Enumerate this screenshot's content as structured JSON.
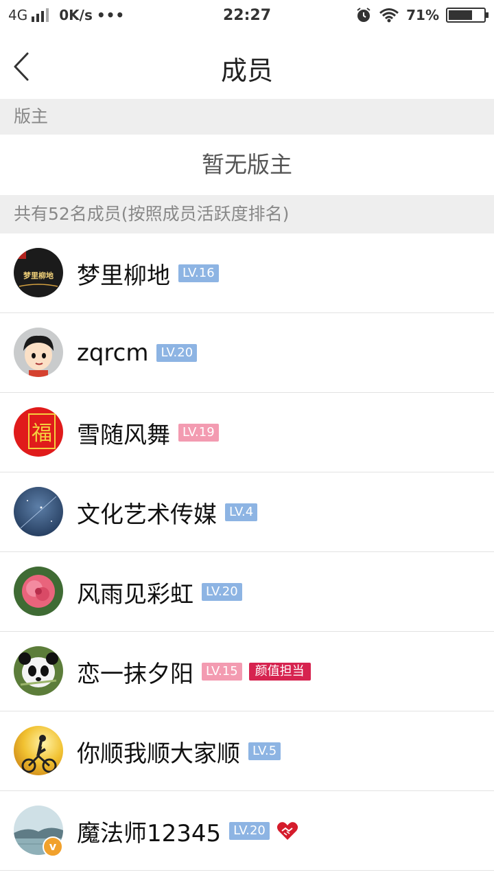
{
  "status_bar": {
    "network": "4G",
    "speed": "0K/s",
    "dots": "•••",
    "time": "22:27",
    "battery": "71%",
    "battery_level": 0.71
  },
  "nav": {
    "title": "成员",
    "back_icon": "chevron-left-icon"
  },
  "moderator_section": {
    "header": "版主",
    "empty_text": "暂无版主"
  },
  "members_section": {
    "header": "共有52名成员(按照成员活跃度排名)"
  },
  "members": [
    {
      "name": "梦里柳地",
      "level": "LV.16",
      "level_color": "#8db4e3"
    },
    {
      "name": "zqrcm",
      "level": "LV.20",
      "level_color": "#8db4e3"
    },
    {
      "name": "雪随风舞",
      "level": "LV.19",
      "level_color": "#f39bb1"
    },
    {
      "name": "文化艺术传媒",
      "level": "LV.4",
      "level_color": "#8db4e3"
    },
    {
      "name": "风雨见彩虹",
      "level": "LV.20",
      "level_color": "#8db4e3"
    },
    {
      "name": "恋一抹夕阳",
      "level": "LV.15",
      "level_color": "#f39bb1",
      "tag": "颜值担当"
    },
    {
      "name": "你顺我顺大家顺",
      "level": "LV.5",
      "level_color": "#8db4e3"
    },
    {
      "name": "魔法师12345",
      "level": "LV.20",
      "level_color": "#8db4e3",
      "badge_icon": "handshake-heart-icon",
      "avatar_badge": "v"
    }
  ],
  "avatar_texts": {
    "m0": "梦里柳地",
    "m2": "福"
  }
}
